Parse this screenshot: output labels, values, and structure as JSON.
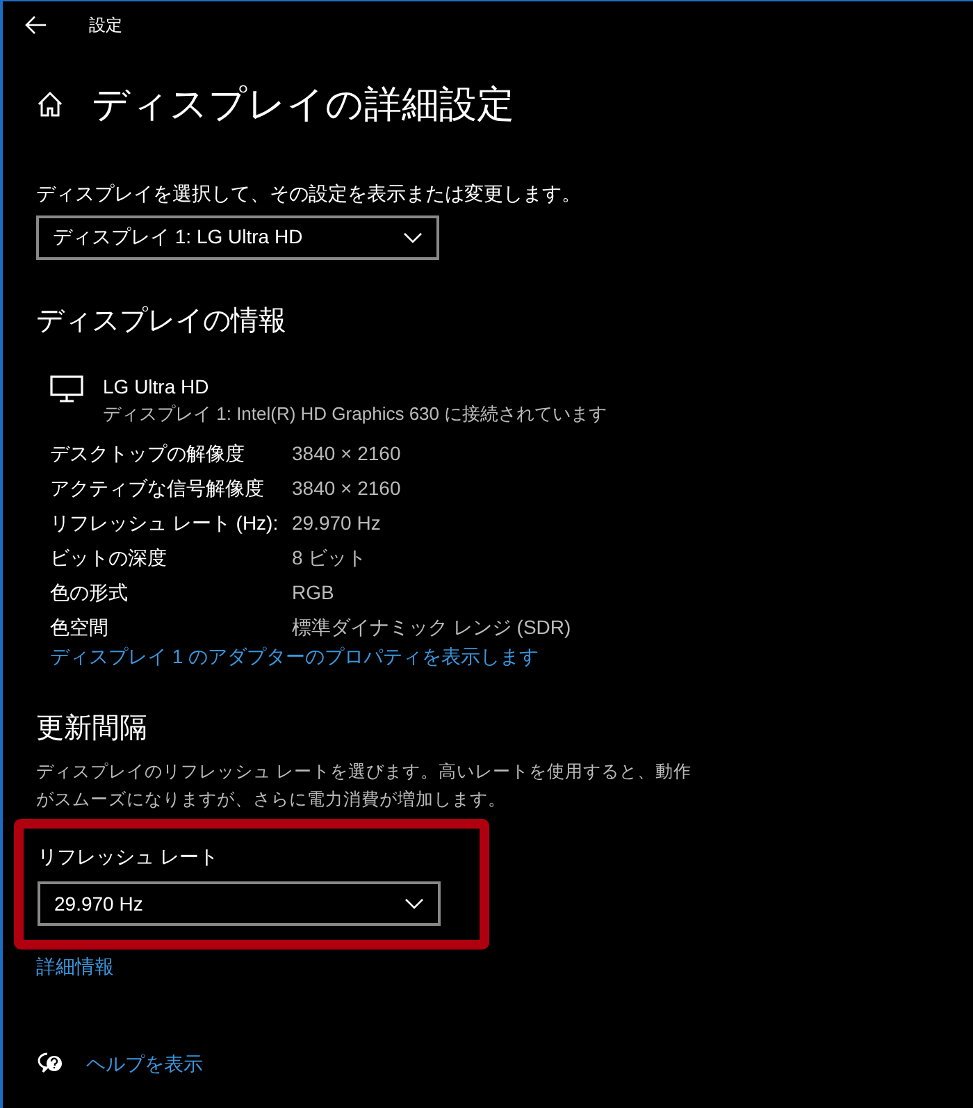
{
  "window": {
    "title": "設定"
  },
  "page_title": "ディスプレイの詳細設定",
  "display_select": {
    "label": "ディスプレイを選択して、その設定を表示または変更します。",
    "value": "ディスプレイ 1: LG Ultra HD"
  },
  "display_info": {
    "heading": "ディスプレイの情報",
    "monitor_name": "LG Ultra HD",
    "monitor_detail": "ディスプレイ 1: Intel(R) HD Graphics 630 に接続されています",
    "rows": [
      {
        "label": "デスクトップの解像度",
        "value": "3840 × 2160"
      },
      {
        "label": "アクティブな信号解像度",
        "value": "3840 × 2160"
      },
      {
        "label": "リフレッシュ レート (Hz):",
        "value": "29.970 Hz"
      },
      {
        "label": "ビットの深度",
        "value": "8 ビット"
      },
      {
        "label": "色の形式",
        "value": "RGB"
      },
      {
        "label": "色空間",
        "value": "標準ダイナミック レンジ (SDR)"
      }
    ],
    "link": "ディスプレイ 1 のアダプターのプロパティを表示します"
  },
  "refresh": {
    "heading": "更新間隔",
    "description": "ディスプレイのリフレッシュ レートを選びます。高いレートを使用すると、動作がスムーズになりますが、さらに電力消費が増加します。",
    "highlighted": true,
    "field_label": "リフレッシュ レート",
    "value": "29.970 Hz",
    "link": "詳細情報"
  },
  "help_link": "ヘルプを表示"
}
